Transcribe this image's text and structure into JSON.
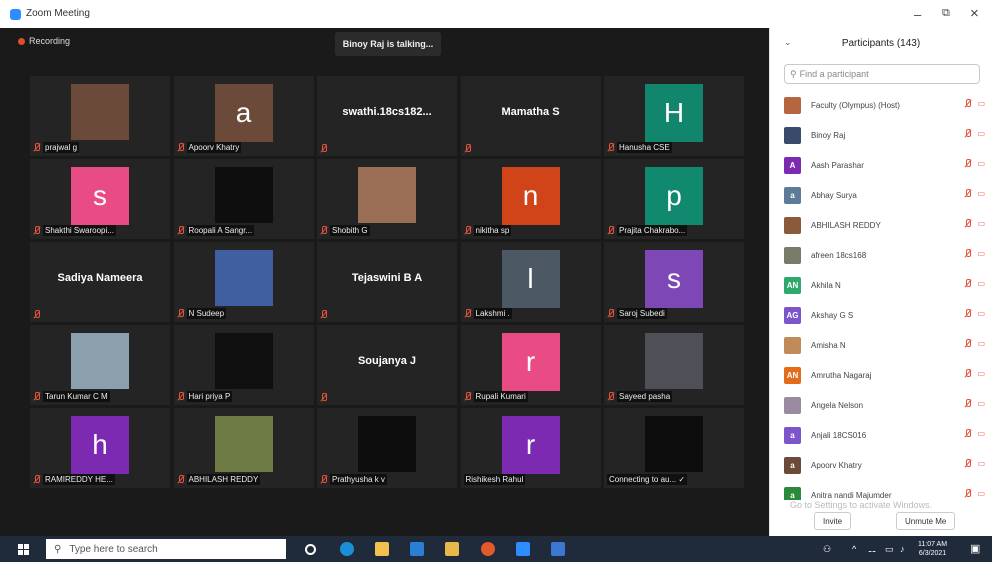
{
  "window": {
    "title": "Zoom Meeting",
    "minimize": "–",
    "restore": "⧉",
    "close": "×"
  },
  "meeting": {
    "recording_label": "Recording",
    "talking": "Binoy Raj is talking...",
    "tiles": [
      {
        "name": "prajwal g",
        "type": "photo",
        "color": "#6b4a3a"
      },
      {
        "name": "Apoorv Khatry",
        "type": "avatar",
        "letter": "a",
        "color": "#6b4a3a"
      },
      {
        "name": "",
        "type": "text",
        "center": "swathi.18cs182..."
      },
      {
        "name": "",
        "type": "text",
        "center": "Mamatha S"
      },
      {
        "name": "Hanusha CSE",
        "type": "avatar",
        "letter": "H",
        "color": "#12866d"
      },
      {
        "name": "Shakthi Swaroopi...",
        "type": "avatar",
        "letter": "s",
        "color": "#e94b84"
      },
      {
        "name": "Roopali A Sangr...",
        "type": "photo",
        "color": "#0e0e0e"
      },
      {
        "name": "Shobith G",
        "type": "photo",
        "color": "#9a6e55"
      },
      {
        "name": "nikitha sp",
        "type": "avatar",
        "letter": "n",
        "color": "#d14419"
      },
      {
        "name": "Prajita Chakrabo...",
        "type": "avatar",
        "letter": "p",
        "color": "#10896f"
      },
      {
        "name": "",
        "type": "text",
        "center": "Sadiya Nameera"
      },
      {
        "name": "N Sudeep",
        "type": "photo",
        "color": "#3f5fa0"
      },
      {
        "name": "",
        "type": "text",
        "center": "Tejaswini B A"
      },
      {
        "name": "Lakshmi .",
        "type": "avatar",
        "letter": "l",
        "color": "#4c5964"
      },
      {
        "name": "Saroj Subedi",
        "type": "avatar",
        "letter": "s",
        "color": "#7e47b6"
      },
      {
        "name": "Tarun Kumar C M",
        "type": "photo",
        "color": "#8ca0ae"
      },
      {
        "name": "Hari priya P",
        "type": "photo",
        "color": "#0f0f0f"
      },
      {
        "name": "",
        "type": "text",
        "center": "Soujanya J"
      },
      {
        "name": "Rupali Kumari",
        "type": "avatar",
        "letter": "r",
        "color": "#e94b84"
      },
      {
        "name": "Sayeed pasha",
        "type": "photo",
        "color": "#4e4f57"
      },
      {
        "name": "RAMIREDDY HE...",
        "type": "avatar",
        "letter": "h",
        "color": "#7b2ab1"
      },
      {
        "name": "ABHILASH REDDY",
        "type": "photo",
        "color": "#6f7b45"
      },
      {
        "name": "Prathyusha k v",
        "type": "photo",
        "color": "#0d0d0d"
      },
      {
        "name": "Rishikesh Rahul",
        "type": "avatar",
        "letter": "r",
        "color": "#7b2ab1",
        "nomic": true
      },
      {
        "name": "Connecting to au... ✓",
        "type": "photo",
        "color": "#0d0d0d",
        "nomic": true
      }
    ]
  },
  "participants": {
    "title": "Participants (143)",
    "search_placeholder": "Find a participant",
    "list": [
      {
        "name": "Faculty (Olympus) (Host)",
        "avatar": "",
        "color": "#b5653f",
        "photo": true
      },
      {
        "name": "Binoy Raj",
        "avatar": "",
        "color": "#3a4a6a",
        "photo": true
      },
      {
        "name": "Aash Parashar",
        "avatar": "A",
        "color": "#7b2ab1"
      },
      {
        "name": "Abhay Surya",
        "avatar": "a",
        "color": "#5d7b99"
      },
      {
        "name": "ABHILASH REDDY",
        "avatar": "",
        "color": "#8a5a3a",
        "photo": true
      },
      {
        "name": "afreen 18cs168",
        "avatar": "",
        "color": "#7a7a6a",
        "photo": true
      },
      {
        "name": "Akhila N",
        "avatar": "AN",
        "color": "#2fa86b"
      },
      {
        "name": "Akshay G S",
        "avatar": "AG",
        "color": "#7b55c9"
      },
      {
        "name": "Amisha N",
        "avatar": "",
        "color": "#c08a5a",
        "photo": true
      },
      {
        "name": "Amrutha Nagaraj",
        "avatar": "AN",
        "color": "#e36c1b"
      },
      {
        "name": "Angela Nelson",
        "avatar": "",
        "color": "#9a8aa0",
        "photo": true
      },
      {
        "name": "Anjali 18CS016",
        "avatar": "a",
        "color": "#7b55c9"
      },
      {
        "name": "Apoorv Khatry",
        "avatar": "a",
        "color": "#6b4a3a"
      },
      {
        "name": "Anitra nandi Majumder",
        "avatar": "a",
        "color": "#2a8a3a"
      }
    ],
    "invite_label": "Invite",
    "unmute_label": "Unmute Me",
    "watermark": "Go to Settings to activate Windows."
  },
  "taskbar": {
    "search_placeholder": "Type here to search",
    "time": "11:07 AM",
    "date": "6/3/2021"
  },
  "colors": {
    "taskbar": "#1f2a3a",
    "zoom_blue": "#2d8cff",
    "mic_off": "#e5533a"
  }
}
